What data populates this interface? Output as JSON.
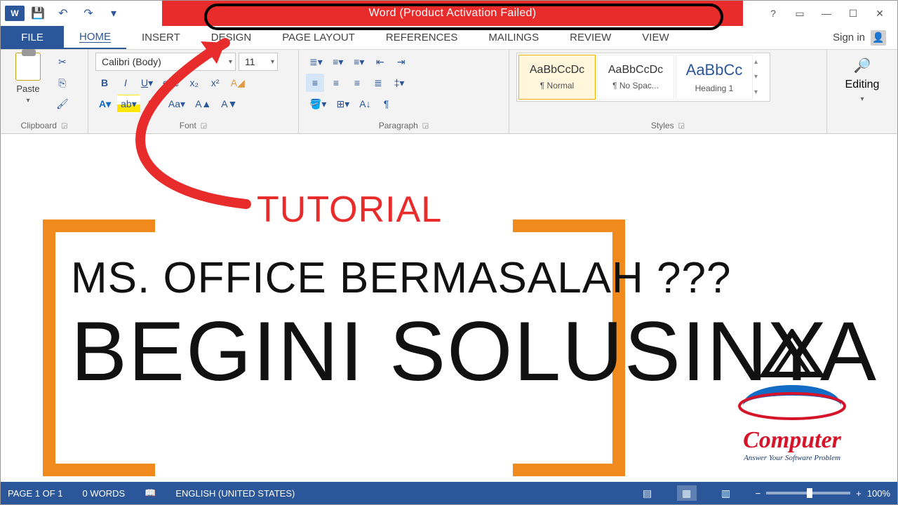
{
  "titlebar": {
    "title": "Word (Product Activation Failed)"
  },
  "tabs": {
    "file": "FILE",
    "items": [
      "HOME",
      "INSERT",
      "DESIGN",
      "PAGE LAYOUT",
      "REFERENCES",
      "MAILINGS",
      "REVIEW",
      "VIEW"
    ],
    "active": "HOME",
    "signin": "Sign in"
  },
  "ribbon": {
    "clipboard": {
      "paste": "Paste",
      "label": "Clipboard"
    },
    "font": {
      "name": "Calibri (Body)",
      "size": "11",
      "label": "Font"
    },
    "paragraph": {
      "label": "Paragraph"
    },
    "styles": {
      "label": "Styles",
      "sample": "AaBbCcDc",
      "sample_h": "AaBbCc",
      "items": [
        "¶ Normal",
        "¶ No Spac...",
        "Heading 1"
      ]
    },
    "editing": {
      "label": "Editing"
    }
  },
  "status": {
    "page": "PAGE 1 OF 1",
    "words": "0 WORDS",
    "lang": "ENGLISH (UNITED STATES)",
    "zoom": "100%"
  },
  "overlay": {
    "tutorial": "TUTORIAL",
    "line1": "MS. OFFICE BERMASALAH ???",
    "line2": "BEGINI SOLUSINYA",
    "logo_text": "Computer",
    "logo_sub": "Answer Your Software Problem"
  }
}
